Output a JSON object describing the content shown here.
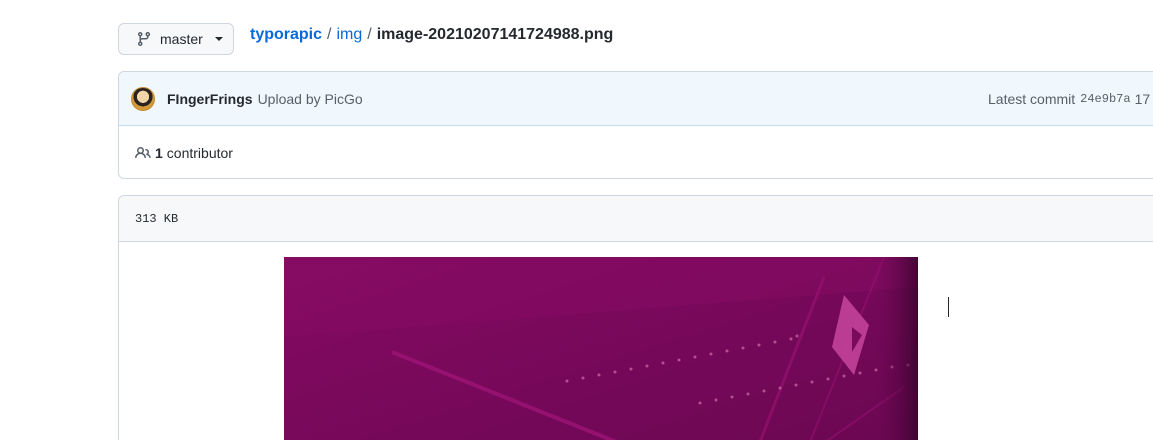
{
  "branch": {
    "label": "master",
    "icon": "git-branch-icon"
  },
  "breadcrumb": {
    "repo": "typorapic",
    "separator": "/",
    "dir": "img",
    "file": "image-20210207141724988.png"
  },
  "commit": {
    "author": "FIngerFrings",
    "message": "Upload by PicGo",
    "latest_label": "Latest commit",
    "sha": "24e9b7a",
    "date": "17"
  },
  "contributors": {
    "icon": "people-icon",
    "count": "1",
    "label": "contributor"
  },
  "file": {
    "size": "313 KB"
  },
  "colors": {
    "link": "#0969da",
    "image_bg": "#7a0a5c",
    "image_accent": "#b01a7a"
  }
}
